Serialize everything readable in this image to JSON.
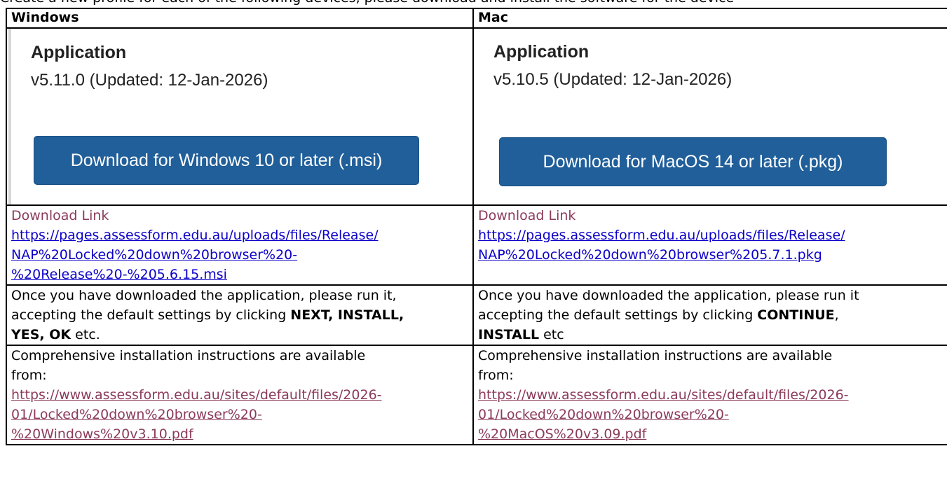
{
  "intro": "Create a new profile for each of the following devices, please download and install the software for the device",
  "headers": {
    "windows": "Windows",
    "mac": "Mac"
  },
  "windows": {
    "app_title": "Application",
    "app_version": "v5.11.0 (Updated: 12-Jan-2026)",
    "download_button": "Download for Windows 10 or later (.msi)",
    "download_label": "Download Link",
    "download_url_lines": [
      "https://pages.assessform.edu.au/uploads/files/Release/",
      "NAP%20Locked%20down%20browser%20-",
      "%20Release%20-%205.6.15.msi"
    ],
    "run_text_prefix": "Once you have downloaded the application, please run it,",
    "run_text_middle": "accepting the default settings by clicking ",
    "run_bold_1": "NEXT, INSTALL,",
    "run_bold_2": "YES, OK",
    "run_text_suffix": " etc.",
    "instructions_text_1": "Comprehensive installation instructions are available",
    "instructions_text_2": "from:",
    "instructions_url_lines": [
      "https://www.assessform.edu.au/sites/default/files/2026-",
      "01/Locked%20down%20browser%20-",
      "%20Windows%20v3.10.pdf"
    ]
  },
  "mac": {
    "app_title": "Application",
    "app_version": "v5.10.5 (Updated: 12-Jan-2026)",
    "download_button": "Download for MacOS 14 or later (.pkg)",
    "download_label": "Download Link",
    "download_url_lines": [
      "https://pages.assessform.edu.au/uploads/files/Release/",
      "NAP%20Locked%20down%20browser%205.7.1.pkg"
    ],
    "run_text_prefix": "Once you have downloaded the application, please run it",
    "run_text_middle": "accepting the default settings by clicking ",
    "run_bold_1": "CONTINUE",
    "run_comma": ",",
    "run_bold_2": "INSTALL",
    "run_text_suffix": " etc",
    "instructions_text_1": "Comprehensive installation instructions are available",
    "instructions_text_2": "from:",
    "instructions_url_lines": [
      "https://www.assessform.edu.au/sites/default/files/2026-",
      "01/Locked%20down%20browser%20-",
      "%20MacOS%20v3.09.pdf"
    ]
  },
  "colors": {
    "button_blue": "#215f9a",
    "link_blue": "#0b00c9",
    "visited_purple": "#8b3a5a"
  }
}
